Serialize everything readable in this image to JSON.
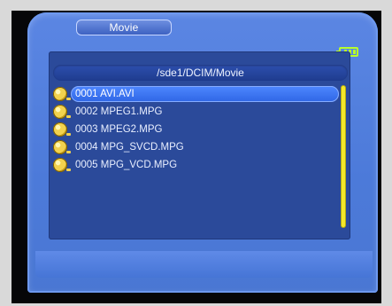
{
  "screen": {
    "title": "Movie",
    "path": "/sde1/DCIM/Movie",
    "selected_index": 0,
    "battery_icon": "battery-icon",
    "colors": {
      "background": "#4c7ad9",
      "panel": "#2b4a9a",
      "highlight": "#3c74f0",
      "scrollbar": "#f4e82a",
      "battery": "#b8ff2a"
    }
  },
  "files": [
    {
      "label": "0001 AVI.AVI"
    },
    {
      "label": "0002 MPEG1.MPG"
    },
    {
      "label": "0003 MPEG2.MPG"
    },
    {
      "label": "0004 MPG_SVCD.MPG"
    },
    {
      "label": "0005 MPG_VCD.MPG"
    }
  ]
}
